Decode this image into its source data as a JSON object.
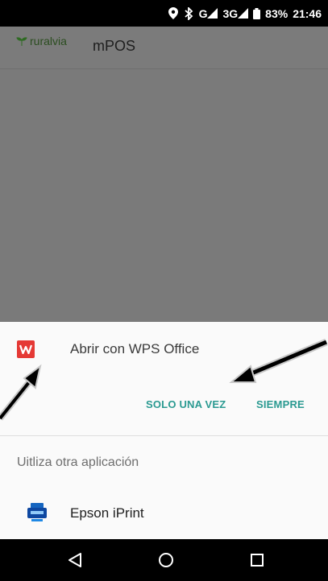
{
  "status_bar": {
    "network_label": "G",
    "network_3g_label": "3G",
    "battery": "83%",
    "time": "21:46"
  },
  "app": {
    "logo_text": "ruralvia",
    "title": "mPOS"
  },
  "chooser": {
    "open_with_label": "Abrir con WPS Office",
    "just_once_label": "SOLO UNA VEZ",
    "always_label": "SIEMPRE",
    "use_other_label": "Uitliza otra aplicación",
    "apps": [
      {
        "name": "Epson iPrint",
        "icon": "epson-iprint-icon"
      }
    ],
    "primary_app_icon": "wps-office-icon",
    "accent_color": "#2a9a91"
  },
  "navigation": {
    "back": "back-icon",
    "home": "home-icon",
    "recents": "recents-icon"
  }
}
